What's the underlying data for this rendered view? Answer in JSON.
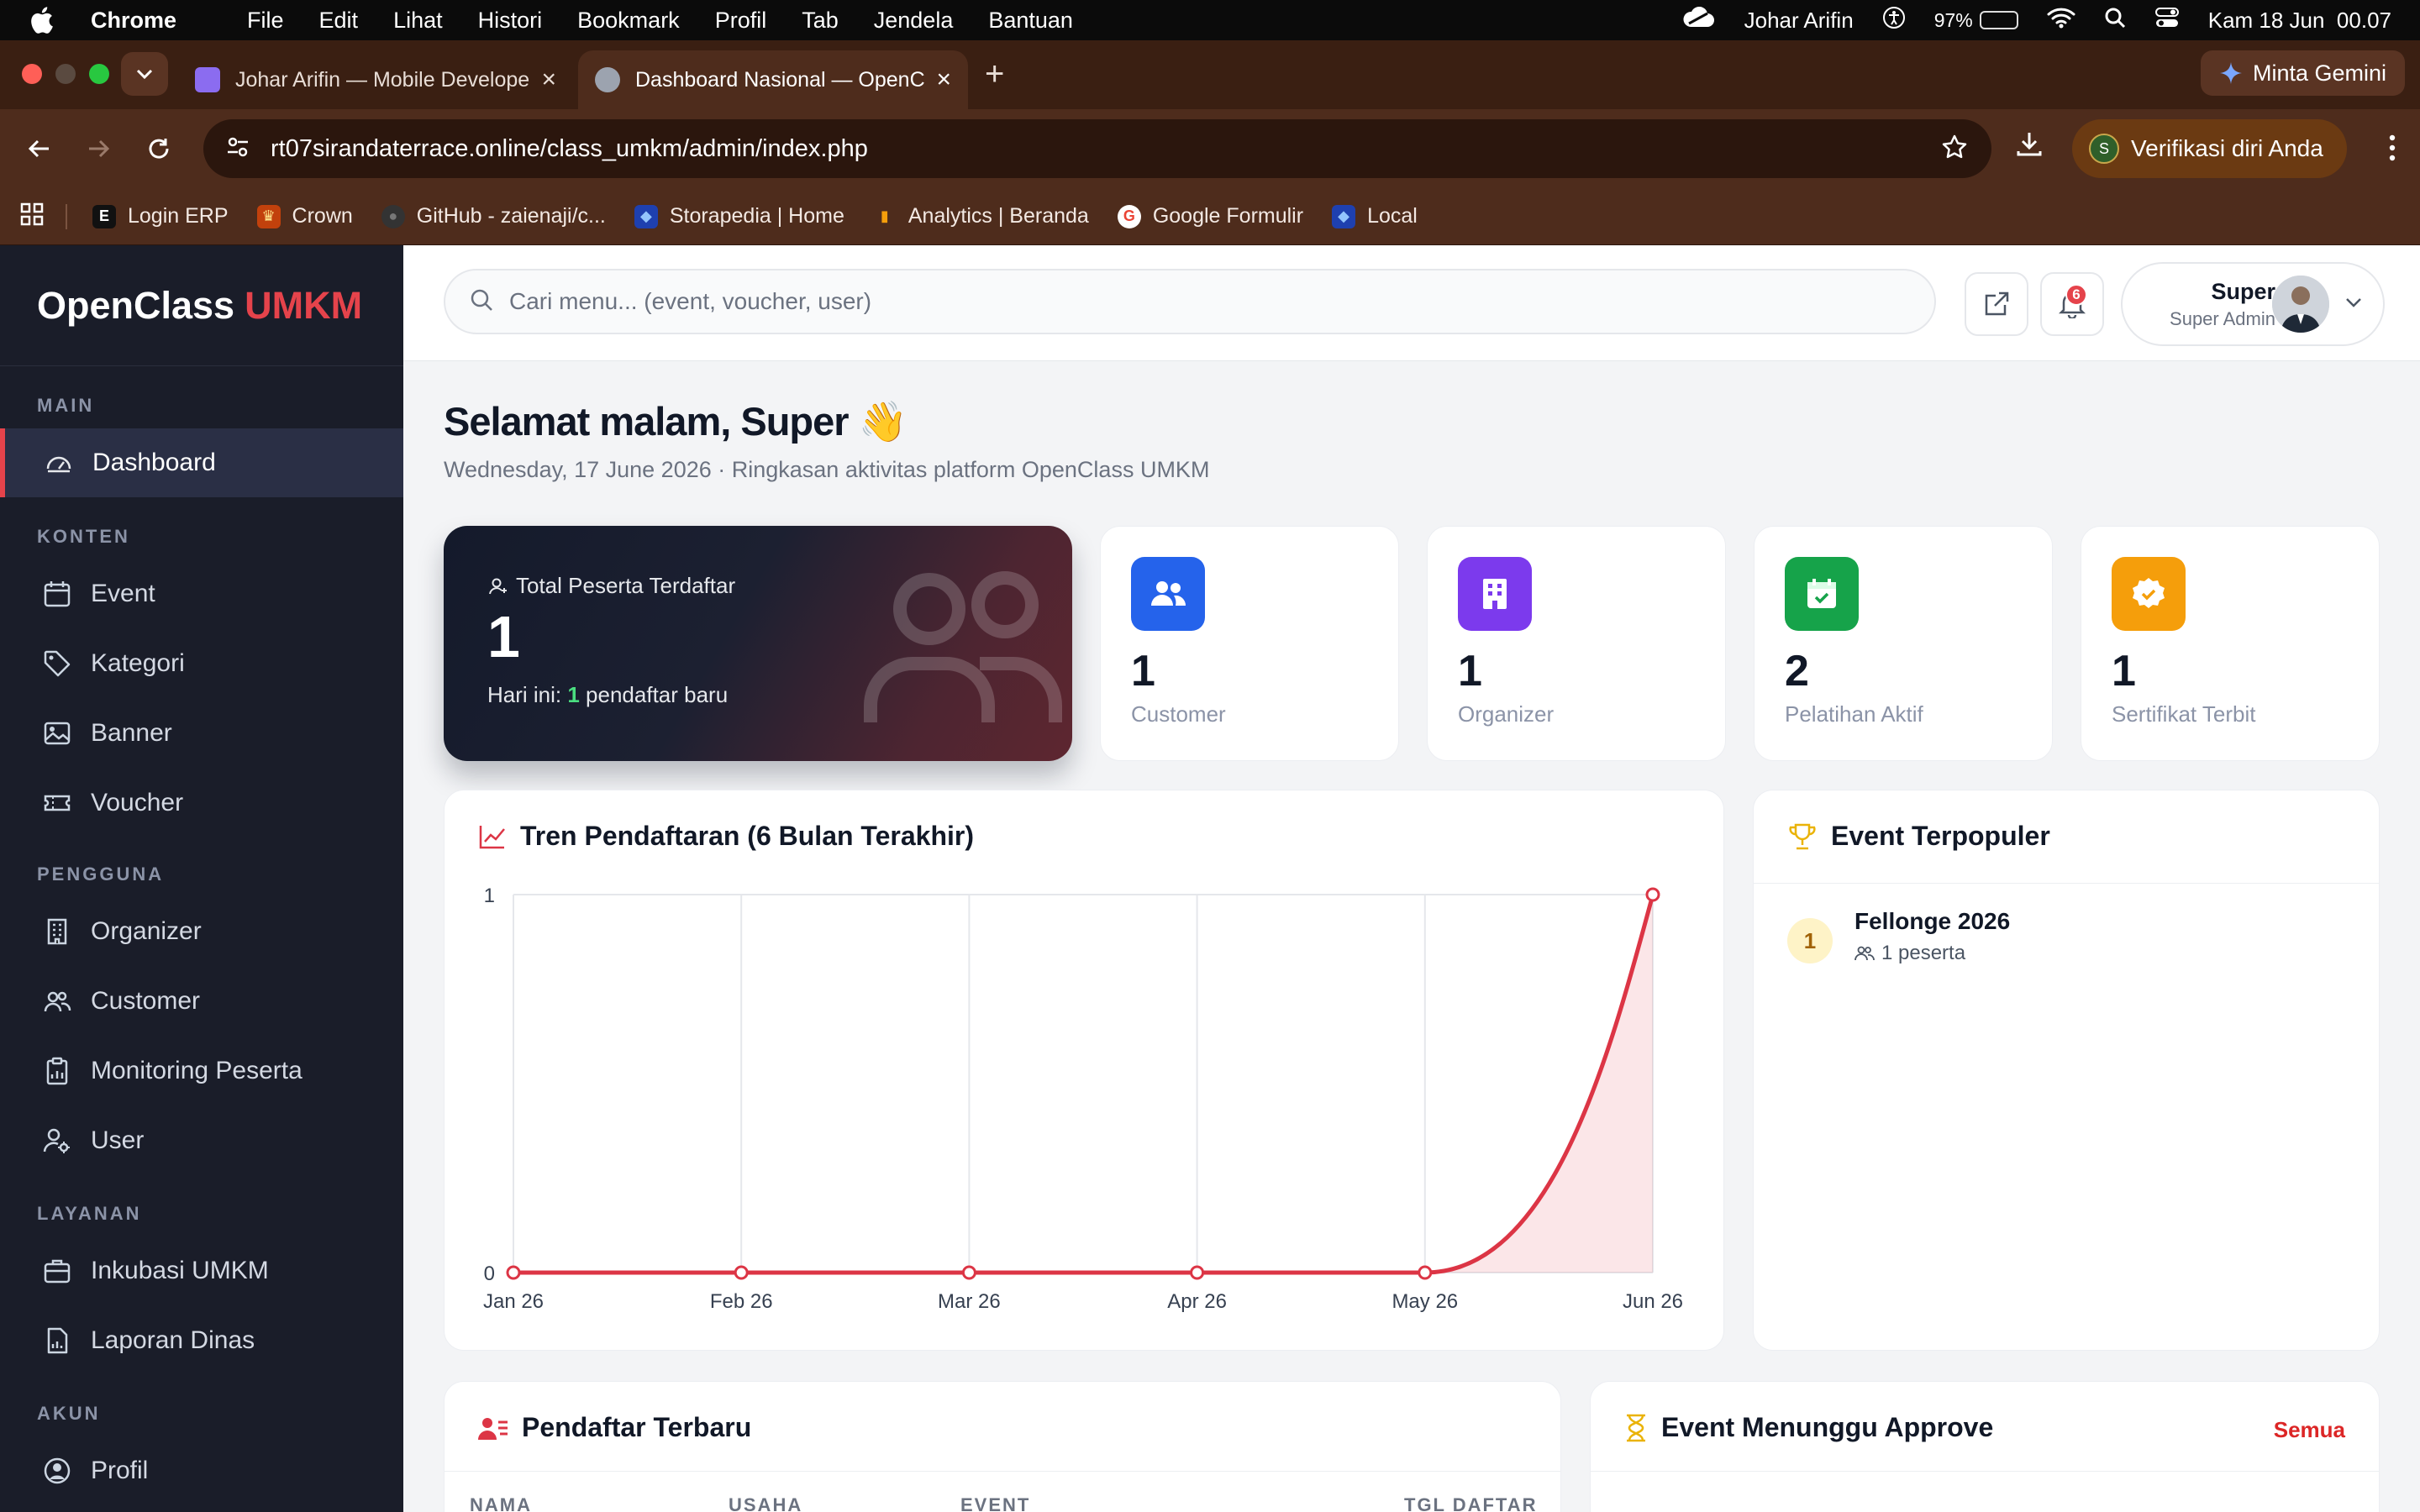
{
  "menubar": {
    "app": "Chrome",
    "items": [
      "File",
      "Edit",
      "Lihat",
      "Histori",
      "Bookmark",
      "Profil",
      "Tab",
      "Jendela",
      "Bantuan"
    ],
    "user": "Johar Arifin",
    "battery": "97%",
    "battery_level": 0.97,
    "clock": "Kam 18 Jun  00.07"
  },
  "browser": {
    "tabs": [
      {
        "title": "Johar Arifin — Mobile Developer",
        "favicon_color": "#8b6cf0"
      },
      {
        "title": "Dashboard Nasional — OpenClass",
        "favicon_color": "#9ca3af"
      }
    ],
    "gemini_label": "Minta Gemini",
    "url": "rt07sirandaterrace.online/class_umkm/admin/index.php",
    "verify_label": "Verifikasi diri Anda",
    "verify_badge": "S",
    "bookmarks": [
      {
        "label": "Login ERP",
        "icon": "E",
        "color": "#111111"
      },
      {
        "label": "Crown",
        "icon": "♛",
        "color": "#c2410c"
      },
      {
        "label": "GitHub - zaienaji/c...",
        "icon": "●",
        "color": "#333333"
      },
      {
        "label": "Storapedia | Home",
        "icon": "◆",
        "color": "#1e40af"
      },
      {
        "label": "Analytics | Beranda",
        "icon": "▮",
        "color": "#f59e0b"
      },
      {
        "label": "Google Formulir",
        "icon": "G",
        "color": "#ffffff"
      },
      {
        "label": "Local",
        "icon": "◆",
        "color": "#1e40af"
      }
    ]
  },
  "sidebar": {
    "logo_main": "OpenClass",
    "logo_accent": "UMKM",
    "sections": [
      {
        "title": "MAIN",
        "items": [
          {
            "label": "Dashboard",
            "icon": "dashboard-icon",
            "active": true
          }
        ]
      },
      {
        "title": "KONTEN",
        "items": [
          {
            "label": "Event",
            "icon": "calendar-icon"
          },
          {
            "label": "Kategori",
            "icon": "tag-icon"
          },
          {
            "label": "Banner",
            "icon": "image-icon"
          },
          {
            "label": "Voucher",
            "icon": "ticket-icon"
          }
        ]
      },
      {
        "title": "PENGGUNA",
        "items": [
          {
            "label": "Organizer",
            "icon": "building-icon"
          },
          {
            "label": "Customer",
            "icon": "users-icon"
          },
          {
            "label": "Monitoring Peserta",
            "icon": "clipboard-icon"
          },
          {
            "label": "User",
            "icon": "user-cog-icon"
          }
        ]
      },
      {
        "title": "LAYANAN",
        "items": [
          {
            "label": "Inkubasi UMKM",
            "icon": "briefcase-icon"
          },
          {
            "label": "Laporan Dinas",
            "icon": "report-icon"
          }
        ]
      },
      {
        "title": "AKUN",
        "items": [
          {
            "label": "Profil",
            "icon": "profile-icon"
          }
        ]
      }
    ]
  },
  "topbar": {
    "search_placeholder": "Cari menu... (event, voucher, user)",
    "notif_count": "6",
    "user_name": "Super",
    "user_role": "Super Admin"
  },
  "greeting": {
    "title": "Selamat malam, Super 👋",
    "subtitle": "Wednesday, 17 June 2026 · Ringkasan aktivitas platform OpenClass UMKM"
  },
  "hero": {
    "label": "Total Peserta Terdaftar",
    "value": "1",
    "foot_prefix": "Hari ini: ",
    "foot_count": "1",
    "foot_suffix": " pendaftar baru"
  },
  "stats": [
    {
      "value": "1",
      "label": "Customer",
      "icon": "users-icon",
      "color": "#2563eb"
    },
    {
      "value": "1",
      "label": "Organizer",
      "icon": "building-icon",
      "color": "#7c3aed"
    },
    {
      "value": "2",
      "label": "Pelatihan Aktif",
      "icon": "calendar-check-icon",
      "color": "#16a34a"
    },
    {
      "value": "1",
      "label": "Sertifikat Terbit",
      "icon": "badge-check-icon",
      "color": "#f59e0b"
    }
  ],
  "chart_title": "Tren Pendaftaran (6 Bulan Terakhir)",
  "chart_data": {
    "type": "area",
    "categories": [
      "Jan 26",
      "Feb 26",
      "Mar 26",
      "Apr 26",
      "May 26",
      "Jun 26"
    ],
    "series": [
      {
        "values": [
          0,
          0,
          0,
          0,
          0,
          1
        ],
        "color": "#dc3545"
      }
    ],
    "ylim": [
      0,
      1
    ],
    "yticks": [
      "0",
      "1"
    ],
    "grid": true
  },
  "popular": {
    "title": "Event Terpopuler",
    "items": [
      {
        "rank": "1",
        "name": "Fellonge 2026",
        "meta": "1 peserta"
      }
    ]
  },
  "registrants": {
    "title": "Pendaftar Terbaru",
    "columns": [
      "NAMA",
      "USAHA",
      "EVENT",
      "TGL DAFTAR"
    ]
  },
  "approval": {
    "title": "Event Menunggu Approve",
    "link": "Semua"
  }
}
